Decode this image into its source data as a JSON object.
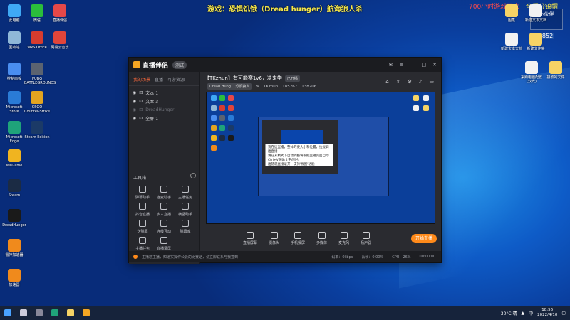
{
  "stream_overlay": {
    "title": "游戏：恐惧饥饿（Dread hunger）航海狼人杀",
    "top_right_red": "700小时游戏玩家",
    "top_right_yellow": "全程分锦帽",
    "badge": "小伙伴",
    "counter": "1852"
  },
  "desktop": {
    "left_icons": [
      {
        "label": "此电脑",
        "color": "#3fa9f5"
      },
      {
        "label": "微信",
        "color": "#2bbd3b"
      },
      {
        "label": "直播伴侣",
        "color": "#e54848"
      },
      {
        "label": "回收站",
        "color": "#8fb8d8"
      },
      {
        "label": "WPS Office",
        "color": "#d63c2f"
      },
      {
        "label": "网易云音乐",
        "color": "#e0453a"
      },
      {
        "label": "控制面板",
        "color": "#4a8ef0"
      },
      {
        "label": "PUBG BATTLEGROUNDS",
        "color": "#5b6370"
      },
      {
        "label": "Microsoft Store",
        "color": "#2a7bd6"
      },
      {
        "label": "CSGO Counter-Strike",
        "color": "#e3a420"
      },
      {
        "label": "Microsoft Edge",
        "color": "#1fa37a"
      },
      {
        "label": "Steam Edition",
        "color": "#1b3a67"
      },
      {
        "label": "WeGame",
        "color": "#f0b420"
      },
      {
        "label": "Steam",
        "color": "#1b2b44"
      },
      {
        "label": "DreadHunger",
        "color": "#1a1a1a"
      },
      {
        "label": "雷神加速器",
        "color": "#f08a1c"
      },
      {
        "label": "加速器",
        "color": "#f08a1c"
      }
    ],
    "right_icons": [
      {
        "label": "图集",
        "color": "#f6d365"
      },
      {
        "label": "新建文本文档",
        "color": "#f2f2f2"
      },
      {
        "label": "新建文本文档",
        "color": "#f2f2f2"
      },
      {
        "label": "新建文件夹",
        "color": "#f6d365"
      },
      {
        "label": "采购电脑配置(双光)",
        "color": "#f2f2f2"
      },
      {
        "label": "接收的文件",
        "color": "#f6d365"
      }
    ]
  },
  "app": {
    "name": "直播伴侣",
    "version": "测试",
    "sidebar_tabs": [
      "我的场景",
      "直播",
      "可游资源"
    ],
    "scenes": [
      {
        "label": "文本 1",
        "dim": false
      },
      {
        "label": "文本 3",
        "dim": false
      },
      {
        "label": "DreadHunger",
        "dim": true
      },
      {
        "label": "全屏 1",
        "dim": false
      }
    ],
    "tools_heading": "工具箱",
    "tools": [
      "弹幕助手",
      "连麦助手",
      "主播任务",
      "抖音直播",
      "多人直播",
      "横竖助手",
      "送弹幕",
      "连线互动",
      "弹幕库",
      "主播任务",
      "直播录屏"
    ],
    "stream_title": "【TKzhun】有可能赛1v6，决来学",
    "stream_tag": "已开播",
    "game_tag": "Dread Hung... 恐惧狼人",
    "user": "TKzhun",
    "fans": "185267",
    "likes": "138206",
    "bottom_tools": [
      "直播屏幕",
      "摄像头",
      "手机投屏",
      "多媒体",
      "麦克风",
      "扬声器"
    ],
    "start_button": "开始直播",
    "status_text": "主播您主播，知道实操作公会的比赛话，请立即联系与我签到",
    "stats": [
      "码率：0kbps",
      "丢帧：0.00%",
      "CPU：26%",
      "00:00:00"
    ],
    "preview_tooltip": [
      "我在这里播，整体的更大小和位置，拉拢调出直播",
      "请在从模式下自动调整将根据主播页面自动",
      "Ctrl+V粘贴文字/图片",
      "出错就直接录开，支持'找图'功能"
    ]
  },
  "taskbar": {
    "weather": "30°C 晴",
    "lang": "中",
    "time": "18:56",
    "date": "2022/4/10"
  }
}
